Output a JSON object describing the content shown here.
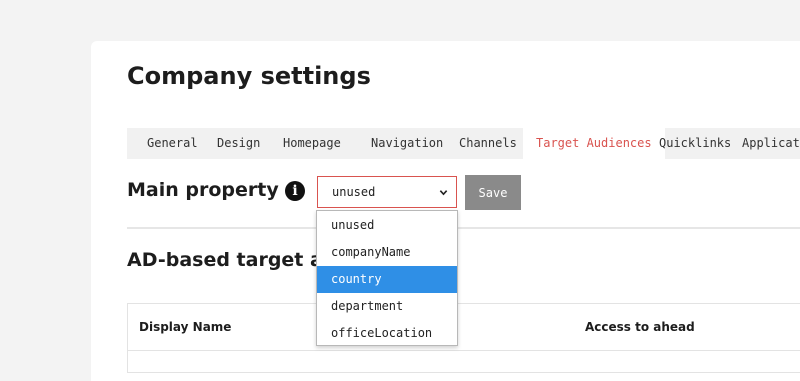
{
  "page": {
    "title": "Company settings"
  },
  "tabs": [
    {
      "label": "General",
      "active": false
    },
    {
      "label": "Design",
      "active": false
    },
    {
      "label": "Homepage",
      "active": false
    },
    {
      "label": "Navigation",
      "active": false
    },
    {
      "label": "Channels",
      "active": false
    },
    {
      "label": "Target Audiences",
      "active": true
    },
    {
      "label": "Quicklinks",
      "active": false
    },
    {
      "label": "Applications",
      "active": false
    }
  ],
  "main_property": {
    "label": "Main property",
    "info_icon": "info-icon",
    "select_value": "unused",
    "save_label": "Save"
  },
  "dropdown": {
    "options": [
      "unused",
      "companyName",
      "country",
      "department",
      "officeLocation"
    ],
    "highlighted": "country"
  },
  "ad_section": {
    "heading": "AD-based target audiences"
  },
  "table": {
    "columns": [
      "Display Name",
      "Access to ahead"
    ]
  },
  "colors": {
    "accent": "#d9534f",
    "highlight": "#2f8fe6",
    "button_gray": "#8a8a8a"
  }
}
